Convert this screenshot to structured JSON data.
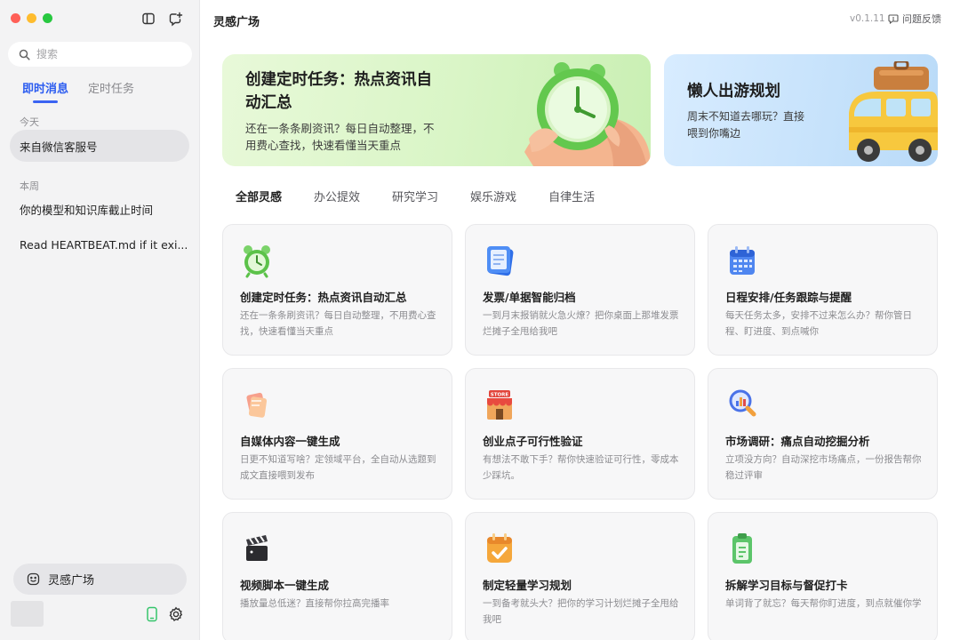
{
  "sidebar": {
    "search_placeholder": "搜索",
    "tabs": [
      {
        "label": "即时消息",
        "active": true
      },
      {
        "label": "定时任务",
        "active": false
      }
    ],
    "sections": [
      {
        "label": "今天",
        "items": [
          {
            "label": "来自微信客服号",
            "active": true
          }
        ]
      },
      {
        "label": "本周",
        "items": [
          {
            "label": "你的模型和知识库截止时间",
            "active": false
          },
          {
            "label": "Read HEARTBEAT.md if it exi...",
            "active": false
          }
        ]
      }
    ],
    "plaza_label": "灵感广场"
  },
  "header": {
    "title": "灵感广场",
    "version": "v0.1.11",
    "feedback_label": "问题反馈"
  },
  "banners": [
    {
      "title_line1": "创建定时任务：热点资讯自",
      "title_line2": "动汇总",
      "desc_line1": "还在一条条刷资讯？每日自动整理，不",
      "desc_line2": "用费心查找，快速看懂当天重点",
      "image": "alarm-clock-in-hand"
    },
    {
      "title": "懒人出游规划",
      "desc_line1": "周末不知道去哪玩？直接",
      "desc_line2": "喂到你嘴边",
      "image": "yellow-van-with-luggage"
    }
  ],
  "categories": [
    {
      "label": "全部灵感",
      "active": true
    },
    {
      "label": "办公提效",
      "active": false
    },
    {
      "label": "研究学习",
      "active": false
    },
    {
      "label": "娱乐游戏",
      "active": false
    },
    {
      "label": "自律生活",
      "active": false
    }
  ],
  "cards": [
    {
      "title": "创建定时任务：热点资讯自动汇总",
      "desc": "还在一条条刷资讯？每日自动整理，不用费心查找，快速看懂当天重点",
      "icon": "alarm-clock-icon"
    },
    {
      "title": "发票/单据智能归档",
      "desc": "一到月末报销就火急火燎？把你桌面上那堆发票烂摊子全甩给我吧",
      "icon": "document-icon"
    },
    {
      "title": "日程安排/任务跟踪与提醒",
      "desc": "每天任务太多，安排不过来怎么办？帮你管日程、盯进度、到点喊你",
      "icon": "calendar-icon"
    },
    {
      "title": "自媒体内容一键生成",
      "desc": "日更不知道写啥？定领域平台，全自动从选题到成文直接喂到发布",
      "icon": "notes-icon"
    },
    {
      "title": "创业点子可行性验证",
      "desc": "有想法不敢下手？帮你快速验证可行性，零成本少踩坑。",
      "icon": "store-icon",
      "icon_text": "STORE"
    },
    {
      "title": "市场调研：痛点自动挖掘分析",
      "desc": "立项没方向？自动深挖市场痛点，一份报告帮你稳过评审",
      "icon": "magnifier-chart-icon"
    },
    {
      "title": "视频脚本一键生成",
      "desc": "播放量总低迷？直接帮你拉高完播率",
      "icon": "clapperboard-icon"
    },
    {
      "title": "制定轻量学习规划",
      "desc": "一到备考就头大？把你的学习计划烂摊子全甩给我吧",
      "icon": "checklist-calendar-icon"
    },
    {
      "title": "拆解学习目标与督促打卡",
      "desc": "单词背了就忘？每天帮你盯进度，到点就催你学",
      "icon": "clipboard-icon"
    }
  ],
  "colors": {
    "accent": "#2b5cf0",
    "sidebar_bg": "#f3f3f4",
    "traffic_red": "#ff5f57",
    "traffic_yellow": "#febc2e",
    "traffic_green": "#28c840",
    "phone_icon": "#34c46a"
  }
}
